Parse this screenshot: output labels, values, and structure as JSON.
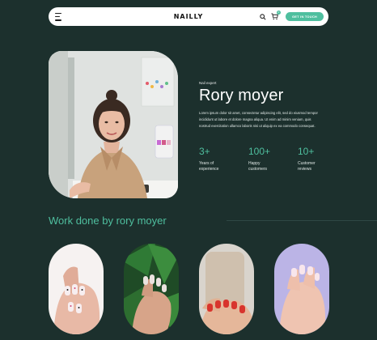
{
  "header": {
    "logo": "NAILLY",
    "cta_label": "GET IN TOUCH",
    "cart_count": "0",
    "icons": [
      "menu-icon",
      "search-icon",
      "cart-icon"
    ]
  },
  "hero": {
    "eyebrow": "Nail expert",
    "name": "Rory moyer",
    "description": "Lorem ipsum dolor sit amet, consectetur adipiscing elit, sed do eiusmod tempor incididunt ut labore et dolore magna aliqua. Ut enim ad minim veniam, quis nostrud exercitation ullamco laboris nisi ut aliquip ex ea commodo consequat.",
    "photo_alt": "Portrait of nail expert"
  },
  "stats": [
    {
      "value": "3+",
      "label": "Years of experience"
    },
    {
      "value": "100+",
      "label": "Happy customers"
    },
    {
      "value": "10+",
      "label": "Customer reviews"
    }
  ],
  "work": {
    "title": "Work done by rory moyer"
  },
  "colors": {
    "background": "#1c302d",
    "accent": "#4fbf9f",
    "navbar": "#ffffff"
  }
}
